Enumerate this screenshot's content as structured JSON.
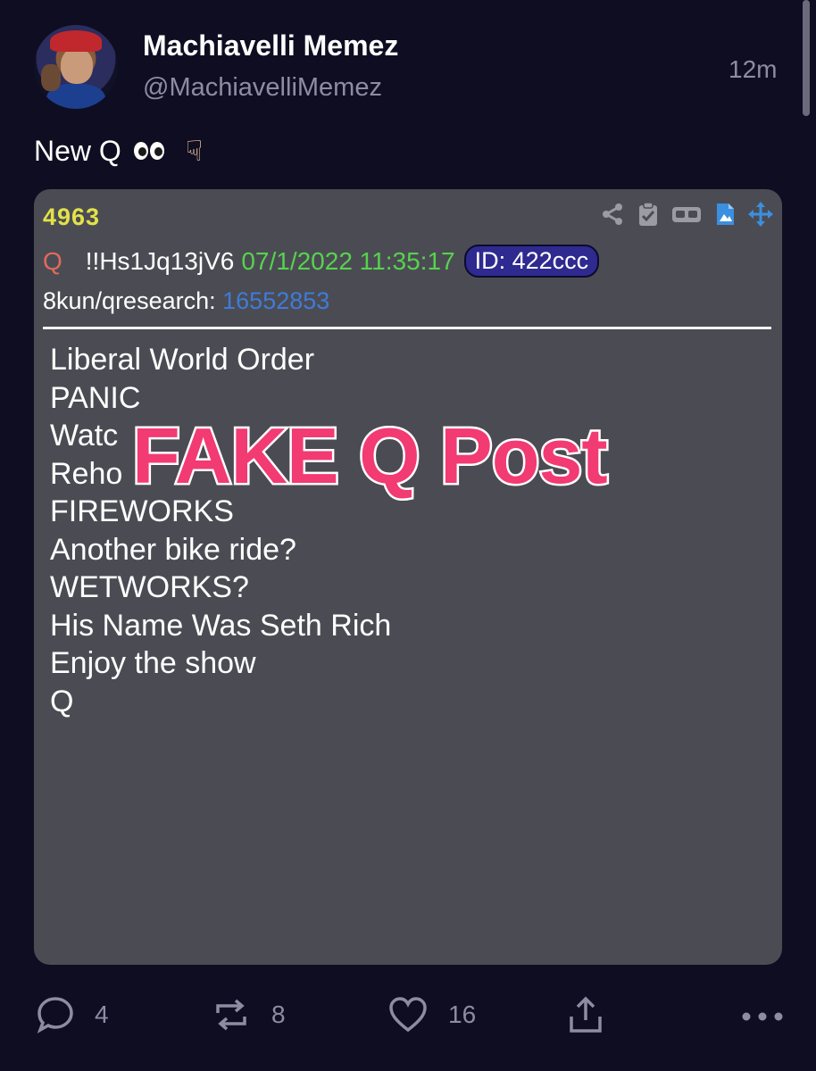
{
  "author": {
    "display_name": "Machiavelli Memez",
    "handle": "@MachiavelliMemez",
    "time_ago": "12m"
  },
  "tweet": {
    "text": "New Q"
  },
  "embedded_post": {
    "post_number": "4963",
    "name": "Q",
    "tripcode": "!!Hs1Jq13jV6",
    "datetime": "07/1/2022 11:35:17",
    "id_badge": "ID: 422ccc",
    "board": "8kun/qresearch:",
    "board_post": "16552853",
    "lines": [
      "Liberal World Order",
      "PANIC",
      "Watc",
      "Reho",
      "FIREWORKS",
      "Another bike ride?",
      "WETWORKS?",
      "His Name Was Seth Rich",
      "Enjoy the show",
      "Q"
    ],
    "overlay_text": "FAKE Q Post",
    "colors": {
      "post_number": "#e2e14a",
      "name": "#e06a5a",
      "datetime": "#57d24f",
      "board_link": "#3f7bd8",
      "overlay": "#f23a73"
    }
  },
  "actions": {
    "replies": "4",
    "reposts": "8",
    "likes": "16"
  }
}
